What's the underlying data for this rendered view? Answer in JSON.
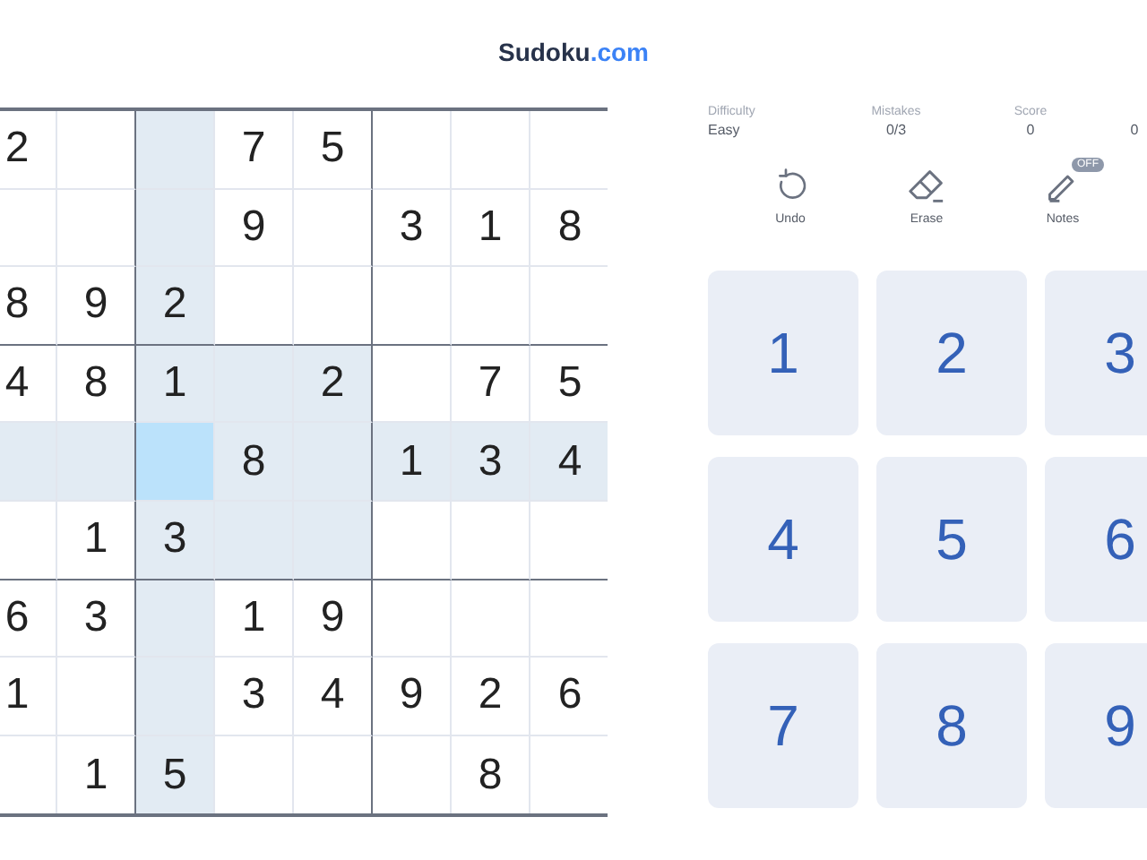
{
  "title": {
    "brand": "Sudoku",
    "suffix": ".com"
  },
  "board": {
    "rows": [
      {
        "cells": [
          {
            "value": "2",
            "selected": false
          },
          {
            "selected": false
          },
          {
            "selected": false
          },
          {
            "value": "7",
            "selected": false
          },
          {
            "value": "5",
            "selected": false
          },
          {
            "selected": false
          },
          {
            "selected": false
          },
          {
            "selected": false
          }
        ]
      },
      {
        "cells": [
          {
            "selected": false
          },
          {
            "selected": false
          },
          {
            "selected": false
          },
          {
            "value": "9",
            "selected": false
          },
          {
            "selected": false
          },
          {
            "value": "3",
            "selected": false
          },
          {
            "value": "1",
            "selected": false
          },
          {
            "value": "8",
            "selected": false
          }
        ]
      },
      {
        "cells": [
          {
            "value": "8",
            "selected": false
          },
          {
            "value": "9",
            "selected": false
          },
          {
            "value": "2",
            "selected": false
          },
          {
            "selected": false
          },
          {
            "selected": false
          },
          {
            "selected": false
          },
          {
            "selected": false
          },
          {
            "selected": false
          }
        ]
      },
      {
        "cells": [
          {
            "value": "4",
            "selected": false
          },
          {
            "value": "8",
            "selected": false
          },
          {
            "value": "1",
            "selected": false
          },
          {
            "selected": false
          },
          {
            "value": "2",
            "selected": false
          },
          {
            "selected": false
          },
          {
            "value": "7",
            "selected": false
          },
          {
            "value": "5",
            "selected": false
          }
        ]
      },
      {
        "cells": [
          {
            "selected": false
          },
          {
            "selected": false
          },
          {
            "selected": true
          },
          {
            "value": "8",
            "selected": false
          },
          {
            "selected": false
          },
          {
            "value": "1",
            "selected": false
          },
          {
            "value": "3",
            "selected": false
          },
          {
            "value": "4",
            "selected": false
          }
        ]
      },
      {
        "cells": [
          {
            "selected": false
          },
          {
            "value": "1",
            "selected": false
          },
          {
            "value": "3",
            "selected": false
          },
          {
            "selected": false
          },
          {
            "selected": false
          },
          {
            "selected": false
          },
          {
            "selected": false
          },
          {
            "selected": false
          }
        ]
      },
      {
        "cells": [
          {
            "value": "6",
            "selected": false
          },
          {
            "value": "3",
            "selected": false
          },
          {
            "selected": false
          },
          {
            "value": "1",
            "selected": false
          },
          {
            "value": "9",
            "selected": false
          },
          {
            "selected": false
          },
          {
            "selected": false
          },
          {
            "selected": false
          }
        ]
      },
      {
        "cells": [
          {
            "value": "1",
            "selected": false
          },
          {
            "selected": false
          },
          {
            "selected": false
          },
          {
            "value": "3",
            "selected": false
          },
          {
            "value": "4",
            "selected": false
          },
          {
            "value": "9",
            "selected": false
          },
          {
            "value": "2",
            "selected": false
          },
          {
            "value": "6",
            "selected": false
          }
        ]
      },
      {
        "cells": [
          {
            "selected": false
          },
          {
            "value": "1",
            "selected": false
          },
          {
            "value": "5",
            "selected": false
          },
          {
            "selected": false
          },
          {
            "selected": false
          },
          {
            "selected": false
          },
          {
            "value": "8",
            "selected": false
          },
          {
            "selected": false
          }
        ]
      }
    ]
  },
  "stats": [
    {
      "label": "Difficulty",
      "value": "Easy"
    },
    {
      "label": "Mistakes",
      "value": "0/3"
    },
    {
      "label": "Score",
      "value": "0"
    },
    {
      "value": "0"
    }
  ],
  "actions": [
    {
      "kind": "undo",
      "label": "Undo"
    },
    {
      "kind": "erase",
      "label": "Erase"
    },
    {
      "kind": "notes",
      "label": "Notes",
      "badge": "OFF",
      "on": false
    }
  ],
  "numpad": [
    "1",
    "2",
    "3",
    "4",
    "5",
    "6",
    "7",
    "8",
    "9"
  ]
}
